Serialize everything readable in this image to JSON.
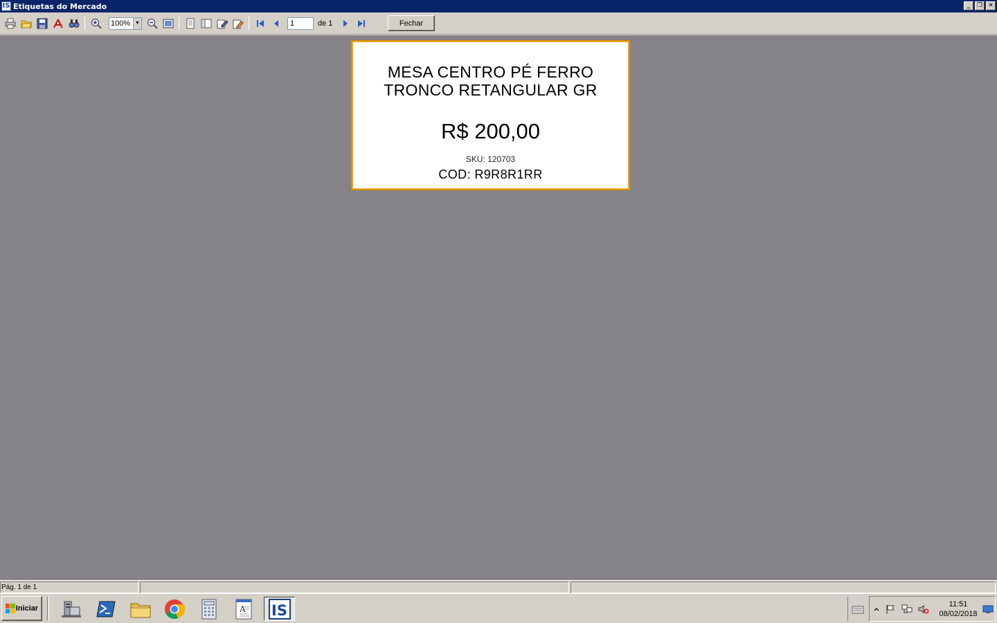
{
  "window": {
    "title": "Etiquetas do Mercado",
    "app_icon_text": "IS",
    "controls": {
      "minimize": "_",
      "restore": "❐",
      "close": "✕"
    }
  },
  "toolbar": {
    "zoom": {
      "value": "100%",
      "options_selected": "100%"
    },
    "page_input": "1",
    "page_total_label": "de 1",
    "close_label": "Fechar",
    "icons": [
      "print-icon",
      "open-folder-icon",
      "save-icon",
      "pdf-icon",
      "find-binoculars-icon",
      "zoom-in-icon",
      "zoom-out-icon",
      "full-page-icon",
      "single-page-icon",
      "multi-page-icon",
      "edit-icon",
      "pencil-icon",
      "first-page-icon",
      "prev-page-icon",
      "next-page-icon",
      "last-page-icon"
    ]
  },
  "label": {
    "product_line1": "MESA CENTRO PÉ FERRO",
    "product_line2": "TRONCO RETANGULAR GR",
    "price": "R$ 200,00",
    "sku": "SKU: 120703",
    "cod": "COD: R9R8R1RR"
  },
  "statusbar": {
    "page_info": "Pág. 1 de 1"
  },
  "taskbar": {
    "start_label": "Iniciar",
    "clock_time": "11:51",
    "clock_date": "08/02/2018",
    "task_icons": [
      "server-manager-icon",
      "powershell-icon",
      "file-explorer-icon",
      "chrome-icon",
      "calculator-icon",
      "document-icon",
      "is-app-icon"
    ]
  },
  "colors": {
    "title_bar": "#0a246a",
    "workspace": "#858388",
    "label_border": "#e8a617",
    "chrome_face": "#d4d0c8"
  }
}
